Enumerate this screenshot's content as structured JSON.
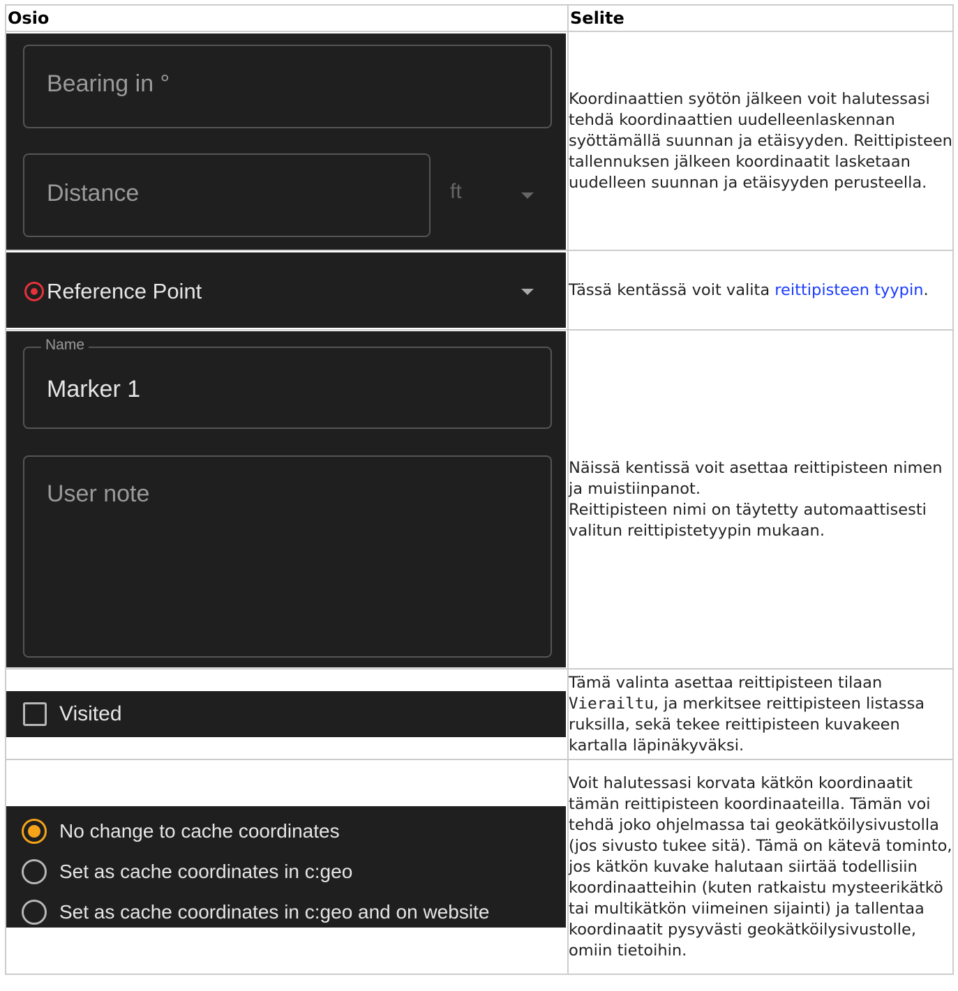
{
  "table": {
    "headers": {
      "col1": "Osio",
      "col2": "Selite"
    }
  },
  "rows": [
    {
      "screen": {
        "bearing_placeholder": "Bearing in °",
        "distance_placeholder": "Distance",
        "unit_value": "ft"
      },
      "desc": "Koordinaattien syötön jälkeen voit halutessasi tehdä koordinaattien uudelleenlaskennan syöttämällä suunnan ja etäisyyden. Reittipisteen tallennuksen jälkeen koordinaatit lasketaan uudelleen suunnan ja etäisyyden perusteella."
    },
    {
      "screen": {
        "type_value": "Reference Point"
      },
      "desc_prefix": "Tässä kentässä voit valita ",
      "desc_link": "reittipisteen tyypin",
      "desc_suffix": "."
    },
    {
      "screen": {
        "name_label": "Name",
        "name_value": "Marker 1",
        "note_placeholder": "User note"
      },
      "desc_line1": "Näissä kentissä voit asettaa reittipisteen nimen ja muistiinpanot.",
      "desc_line2": "Reittipisteen nimi on täytetty automaattisesti valitun reittipistetyypin mukaan."
    },
    {
      "screen": {
        "checkbox_label": "Visited"
      },
      "desc_prefix": "Tämä valinta asettaa reittipisteen tilaan ",
      "desc_code": "Vierailtu",
      "desc_suffix": ", ja merkitsee reittipisteen listassa ruksilla, sekä tekee reittipisteen kuvakeen kartalla läpinäkyväksi."
    },
    {
      "screen": {
        "options": [
          "No change to cache coordinates",
          "Set as cache coordinates in c:geo",
          "Set as cache coordinates in c:geo and on website"
        ],
        "selected_index": 0
      },
      "desc": "Voit halutessasi korvata kätkön koordinaatit tämän reittipisteen koordinaateilla. Tämän voi tehdä joko ohjelmassa tai geokätköilysivustolla (jos sivusto tukee sitä). Tämä on kätevä tominto, jos kätkön kuvake halutaan siirtää todellisiin koordinaatteihin (kuten ratkaistu mysteerikätkö tai multikätkön viimeinen sijainti) ja tallentaa koordinaatit pysyvästi geokätköilysivustolle, omiin tietoihin."
    }
  ],
  "colors": {
    "dark_bg": "#1f1f1f",
    "accent_orange": "#f5a41a",
    "reference_red": "#e5323a",
    "link_blue": "#1a3cff",
    "border": "#cccccc"
  },
  "icons": [
    "reference-point-icon",
    "dropdown-arrow-icon",
    "checkbox-icon",
    "radio-icon"
  ]
}
